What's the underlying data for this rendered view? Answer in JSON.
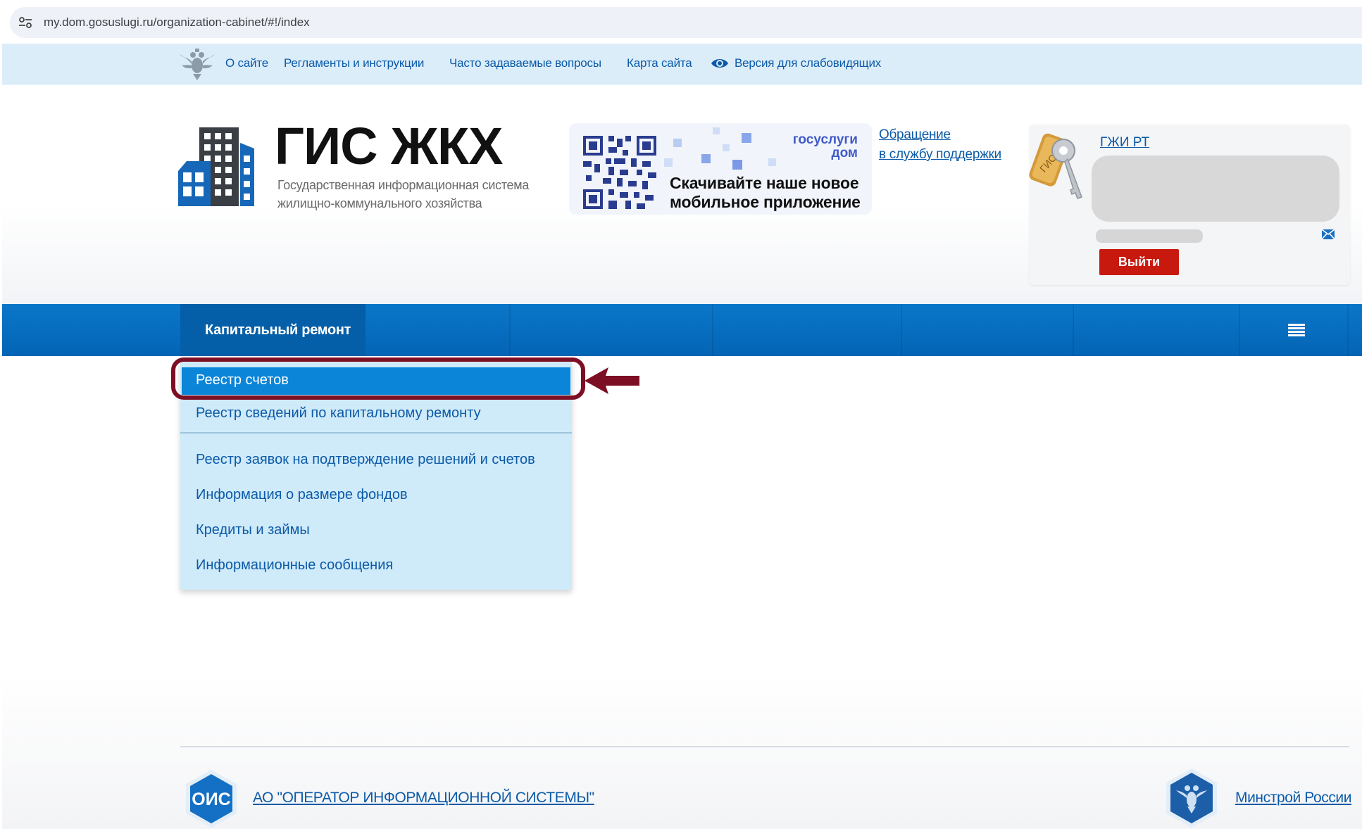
{
  "browser": {
    "url": "my.dom.gosuslugi.ru/organization-cabinet/#!/index"
  },
  "top_links": {
    "items": [
      "О сайте",
      "Регламенты и инструкции",
      "Часто задаваемые вопросы",
      "Карта сайта",
      "Версия для слабовидящих"
    ]
  },
  "header": {
    "logo_title": "ГИС ЖКХ",
    "logo_subtitle_line1": "Государственная информационная система",
    "logo_subtitle_line2": "жилищно-коммунального хозяйства",
    "promo": {
      "brand_line1": "госуслуги",
      "brand_line2": "дом",
      "cta_line1": "Скачивайте наше новое",
      "cta_line2": "мобильное приложение"
    },
    "support_line1": "Обращение",
    "support_line2": "в службу поддержки",
    "user": {
      "org_link": "ГЖИ РТ",
      "logout_label": "Выйти"
    }
  },
  "nav": {
    "active_label": "Капитальный ремонт",
    "menu_icon": "hamburger-menu-icon"
  },
  "dropdown": {
    "active_item": "Реестр счетов",
    "items": [
      "Реестр сведений по капитальному ремонту",
      "Реестр заявок на подтверждение решений и счетов",
      "Информация о размере фондов",
      "Кредиты и займы",
      "Информационные сообщения"
    ]
  },
  "footer": {
    "ois_logo_text": "ОИС",
    "ois_link": "АО \"ОПЕРАТОР ИНФОРМАЦИОННОЙ СИСТЕМЫ\"",
    "minstroy_link": "Минстрой России"
  },
  "colors": {
    "nav_blue": "#0464b5",
    "link_blue": "#0b5aa8",
    "dropdown_bg": "#cfeaf9",
    "dropdown_active": "#0a85d8",
    "logout_red": "#c8190f",
    "highlight": "#7d0f24"
  }
}
